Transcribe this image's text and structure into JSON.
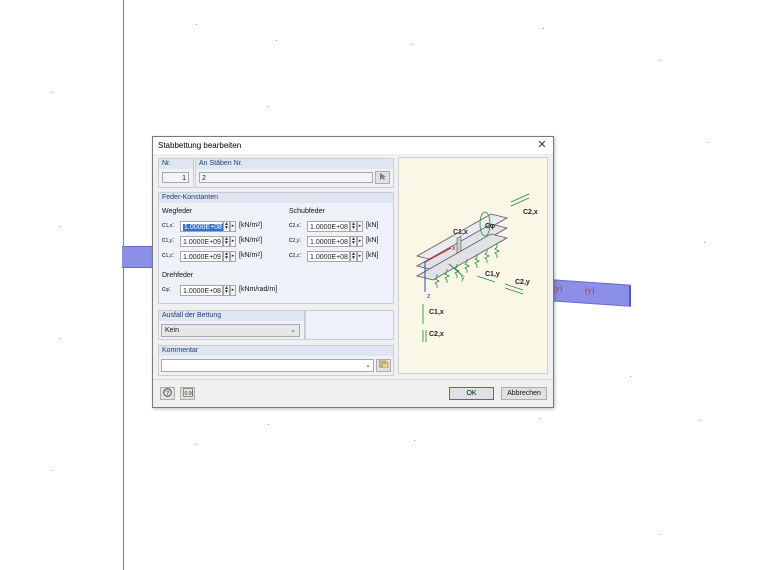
{
  "dialog": {
    "title": "Stabbettung bearbeiten",
    "close_glyph": "✕",
    "nr_label": "Nr.",
    "nr_value": "1",
    "members_label": "An Stäben Nr.",
    "members_value": "2",
    "constants_section": "Feder-Konstanten",
    "translational_label": "Wegfeder",
    "shear_label": "Schubfeder",
    "rotational_label": "Drehfeder",
    "springs": {
      "c1x": {
        "value": "1.0000E+08",
        "unit_base": "[kN/m",
        "unit_sup": "2",
        "unit_end": "]"
      },
      "c1y": {
        "value": "1.0000E+09",
        "unit_base": "[kN/m",
        "unit_sup": "2",
        "unit_end": "]"
      },
      "c1z": {
        "value": "1.0000E+09",
        "unit_base": "[kN/m",
        "unit_sup": "2",
        "unit_end": "]"
      },
      "c2x": {
        "value": "1.0000E+08",
        "unit": "[kN]"
      },
      "c2y": {
        "value": "1.0000E+08",
        "unit": "[kN]"
      },
      "c2z": {
        "value": "1.0000E+08",
        "unit": "[kN]"
      },
      "cphi": {
        "value": "1.0000E+08",
        "unit": "[kNm/rad/m]"
      }
    },
    "failure_section": "Ausfall der Bettung",
    "failure_value": "Kein",
    "comment_section": "Kommentar",
    "comment_value": "",
    "ok_label": "OK",
    "cancel_label": "Abbrechen"
  },
  "diagram_labels": {
    "c1x": "C1,x",
    "c2x": "C2,x",
    "c1y": "C1,y",
    "c2y": "C2,y",
    "cphi": "Cφ",
    "x": "x",
    "y": "y",
    "z": "z"
  },
  "scene": {
    "member_label": "(y)"
  },
  "colors": {
    "accent_blue": "#2f73cf",
    "beam": "#8b8fe6",
    "spring_green": "#1e8a3c",
    "axis_red": "#d0202a"
  }
}
